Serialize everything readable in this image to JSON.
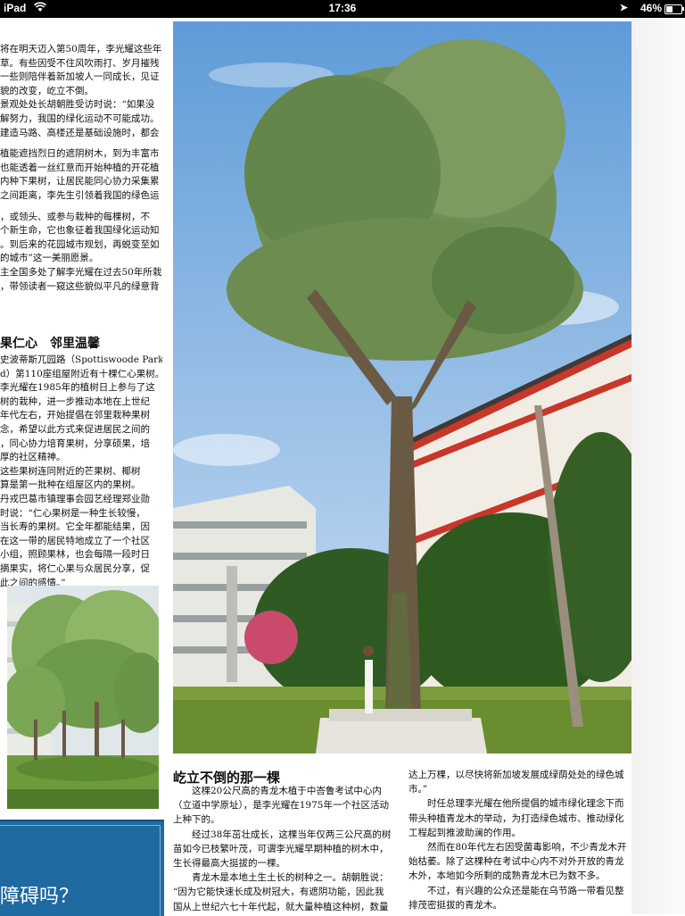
{
  "status_bar": {
    "carrier": "iPad",
    "time": "17:36",
    "battery": "46%"
  },
  "left_column": {
    "para1": [
      "将在明天迈入第50周年，李光耀这些年",
      "草。有些因受不住风吹雨打、岁月摧残",
      "一些则陪伴着新加坡人一同成长，见证",
      "貌的改变，屹立不倒。",
      "景观处处长胡朝胜受访时说：“如果没",
      "解努力，我国的绿化运动不可能成功。",
      "建造马路、高楼还是基础设施时，都会"
    ],
    "para2": [
      "植能遮挡烈日的遮阴树木，到为丰富市",
      "也能透着一丝红意而开始种植的开花植",
      "内种下果树，让居民能同心协力采集累",
      "之间距离，李先生引领着我国的绿色运"
    ],
    "para3": [
      "，或领头、或参与栽种的每棵树，不",
      "个新生命，它也象征着我国绿化运动知",
      "。到后来的花园城市规划，再蜕变至如",
      "的城市”这一美丽愿景。",
      "主全国多处了解李光耀在过去50年所栽",
      "，带领读者一窥这些貌似平凡的绿意背"
    ],
    "subhead": "果仁心　邻里温馨",
    "para4": [
      "史波蒂斯兀园路（Spottiswoode Park",
      "d）第110座组屋附近有十棵仁心果树。",
      "李光耀在1985年的植树日上参与了这",
      "树的栽种，进一步推动本地在上世纪",
      "年代左右，开始提倡在邻里栽种果树",
      "念，希望以此方式来促进居民之间的",
      "，同心协力培育果树，分享硕果，培",
      "厚的社区精神。",
      "这些果树连同附近的芒果树、椰树",
      "算是第一批种在组屋区内的果树。",
      "丹戎巴葛市镇理事会园艺经理郑业勋",
      "时说：“仁心果树是一种生长较慢，",
      "当长寿的果树。它全年都能结果，因",
      "在这一带的居民特地成立了一个社区",
      "小组，照顾果林，也会每隔一段时日",
      "摘果实，将仁心果与众居民分享，促",
      "此之间的感情。”"
    ]
  },
  "blue_box": {
    "title": "障碍吗？"
  },
  "article": {
    "headline": "屹立不倒的那一棵",
    "col1": [
      "　　这棵20公尺高的青龙木植于中峇鲁考试中心内",
      "（立道中学原址），是李光耀在1975年一个社区活动",
      "上种下的。",
      "　　经过38年茁壮成长，这棵当年仅两三公尺高的树",
      "苗如今已枝繁叶茂，可谓李光耀早期种植的树木中，",
      "生长得最高大挺拔的一棵。",
      "　　青龙木是本地土生土长的树种之一。胡朝胜说：",
      "“因为它能快速长成及树冠大，有遮阴功能，因此我",
      "国从上世纪六七十年代起，就大量种植这种树，数量"
    ],
    "col2": [
      "达上万棵，以尽快将新加坡发展成绿荫处处的绿色城",
      "市。”",
      "　　时任总理李光耀在他所提倡的城市绿化理念下而",
      "带头种植青龙木的举动，为打造绿色城市、推动绿化",
      "工程起到推波助澜的作用。",
      "　　然而在80年代左右因受菌毒影响，不少青龙木开",
      "始枯萎。除了这棵种在考试中心内不对外开放的青龙",
      "木外，本地如今所剩的成熟青龙木已为数不多。",
      "　　不过，有兴趣的公众还是能在乌节路一带看见整",
      "排茂密挺拔的青龙木。"
    ]
  }
}
